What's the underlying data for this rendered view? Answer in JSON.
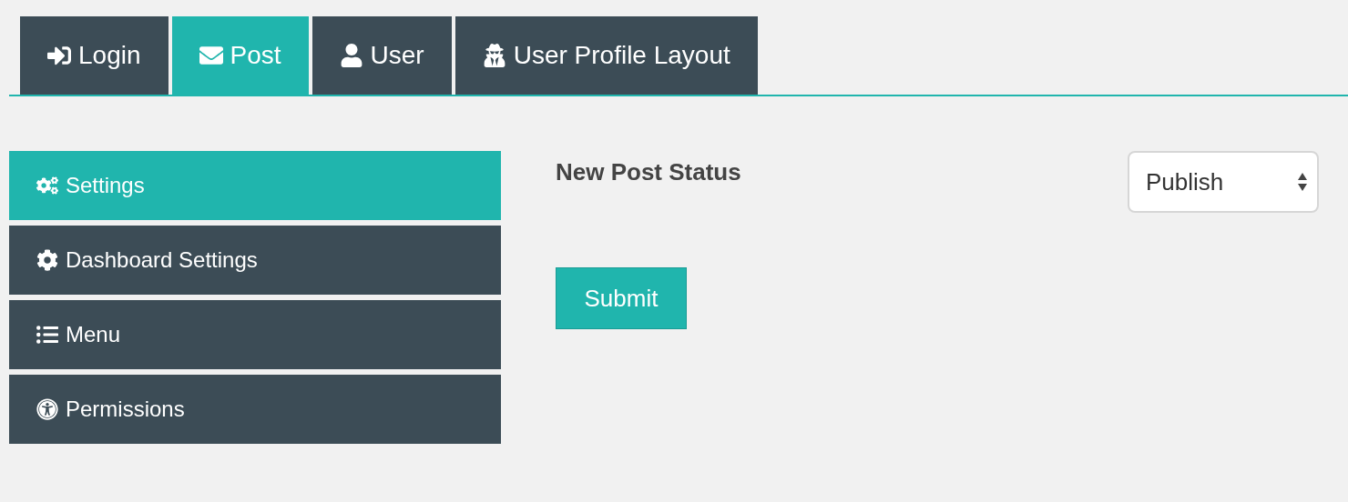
{
  "tabs": [
    {
      "label": "Login",
      "selected": false
    },
    {
      "label": "Post",
      "selected": true
    },
    {
      "label": "User",
      "selected": false
    },
    {
      "label": "User Profile Layout",
      "selected": false
    }
  ],
  "sidebar": {
    "items": [
      {
        "label": "Settings",
        "selected": true
      },
      {
        "label": "Dashboard Settings",
        "selected": false
      },
      {
        "label": "Menu",
        "selected": false
      },
      {
        "label": "Permissions",
        "selected": false
      }
    ]
  },
  "form": {
    "field_label": "New Post Status",
    "select_value": "Publish",
    "submit": "Submit"
  }
}
